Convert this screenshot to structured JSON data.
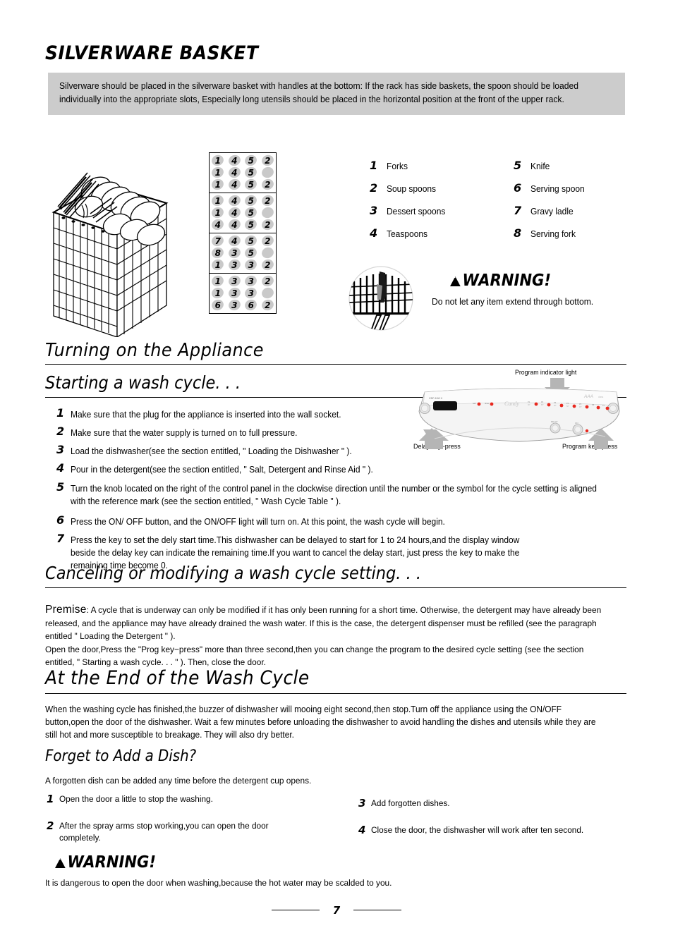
{
  "section_silverware": {
    "title": "SILVERWARE BASKET",
    "intro": "Silverware should be placed in the silverware basket with handles at the bottom: If the rack has side baskets, the spoon should be loaded individually into the appropriate slots, Especially long utensils should be placed in the horizontal position at the front of the upper rack.",
    "grid": [
      [
        [
          "1",
          "4",
          "5",
          "2"
        ],
        [
          "1",
          "4",
          "5",
          ""
        ],
        [
          "1",
          "4",
          "5",
          "2"
        ]
      ],
      [
        [
          "1",
          "4",
          "5",
          "2"
        ],
        [
          "1",
          "4",
          "5",
          ""
        ],
        [
          "4",
          "4",
          "5",
          "2"
        ]
      ],
      [
        [
          "7",
          "4",
          "5",
          "2"
        ],
        [
          "8",
          "3",
          "5",
          ""
        ],
        [
          "1",
          "3",
          "3",
          "2"
        ]
      ],
      [
        [
          "1",
          "3",
          "3",
          "2"
        ],
        [
          "1",
          "3",
          "3",
          ""
        ],
        [
          "6",
          "3",
          "6",
          "2"
        ]
      ]
    ],
    "legend_left": [
      {
        "n": "1",
        "label": "Forks"
      },
      {
        "n": "2",
        "label": "Soup spoons"
      },
      {
        "n": "3",
        "label": "Dessert spoons"
      },
      {
        "n": "4",
        "label": "Teaspoons"
      }
    ],
    "legend_right": [
      {
        "n": "5",
        "label": "Knife"
      },
      {
        "n": "6",
        "label": "Serving spoon"
      },
      {
        "n": "7",
        "label": "Gravy ladle"
      },
      {
        "n": "8",
        "label": "Serving fork"
      }
    ],
    "warning_label": "WARNING!",
    "warning_text": "Do not let any item extend through bottom."
  },
  "section_turning_on": {
    "title": "Turning on the Appliance",
    "subtitle": "Starting a wash cycle. . .",
    "steps": [
      {
        "n": "1",
        "text": "Make sure that the plug for the appliance is inserted into the wall socket."
      },
      {
        "n": "2",
        "text": "Make sure that the water supply is turned on to full pressure."
      },
      {
        "n": "3",
        "text": "Load the dishwasher(see the section entitled, \" Loading the Dishwasher \" )."
      },
      {
        "n": "4",
        "text": "Pour in the detergent(see the section entitled, \" Salt, Detergent and Rinse Aid \" )."
      },
      {
        "n": "5",
        "text": "Turn the knob located on the right of the control panel in the clockwise direction until the number or the symbol for the cycle setting is aligned with the reference mark (see the section entitled, \" Wash Cycle Table \" )."
      },
      {
        "n": "6",
        "text": "Press the ON/ OFF button, and the ON/OFF light will turn on. At this point, the wash cycle will begin."
      },
      {
        "n": "7",
        "text": "Press the key to set the dely start time.This dishwasher can be delayed to start for 1 to 24 hours,and the display window beside the delay key can indicate the remaining time.If you want to cancel the delay start, just press the key to make the remaining time become 0."
      }
    ],
    "panel": {
      "indicator_label": "Program indicator light",
      "delay_label": "Delay key−press",
      "program_label": "Program key−press",
      "brand": "CANDY"
    }
  },
  "section_cancel": {
    "title": "Canceling or modifying a wash cycle setting. . .",
    "premise_word": "Premise",
    "premise_body": ": A cycle that is underway can only be modified if it has only been running for a short time. Otherwise, the detergent may have already been released, and the appliance may have already drained the wash water. If this is the case, the detergent dispenser must be refilled (see the paragraph entitled \" Loading the Detergent \" ).",
    "paragraph2": "Open the door,Press the \"Prog key−press\" more than three second,then you can change  the program  to the  desired cycle  setting  (see the section entitled, \" Starting a wash cycle. . . \" ). Then, close the door."
  },
  "section_end": {
    "title": "At the End of the Wash Cycle",
    "body": "When the washing cycle has finished,the buzzer of dishwasher will mooing eight second,then stop.Turn off the appliance using the ON/OFF button,open the door of the dishwasher. Wait a few minutes before unloading the dishwasher to avoid handling the dishes and utensils while they are still hot and more susceptible to breakage. They will also dry better."
  },
  "section_forget": {
    "title": "Forget to Add a Dish?",
    "intro": "A forgotten dish can be added any time before the detergent cup opens.",
    "steps_left": [
      {
        "n": "1",
        "text": "Open the door a little to stop the washing."
      },
      {
        "n": "2",
        "text": "After the spray arms stop working,you can open the door completely."
      }
    ],
    "steps_right": [
      {
        "n": "3",
        "text": "Add forgotten dishes."
      },
      {
        "n": "4",
        "text": "Close the door, the dishwasher will work after ten second."
      }
    ]
  },
  "warning_bottom": {
    "label": "WARNING!",
    "text": "It is dangerous to open the door when washing,because the hot water may be scalded to you."
  },
  "footer": {
    "page_number": "7"
  },
  "colors": {
    "band_gray": "#cccccc",
    "blob_gray": "#c9c9c9",
    "arrow_gray": "#b5b5b5",
    "led_red": "#e8281e",
    "text": "#000000"
  }
}
